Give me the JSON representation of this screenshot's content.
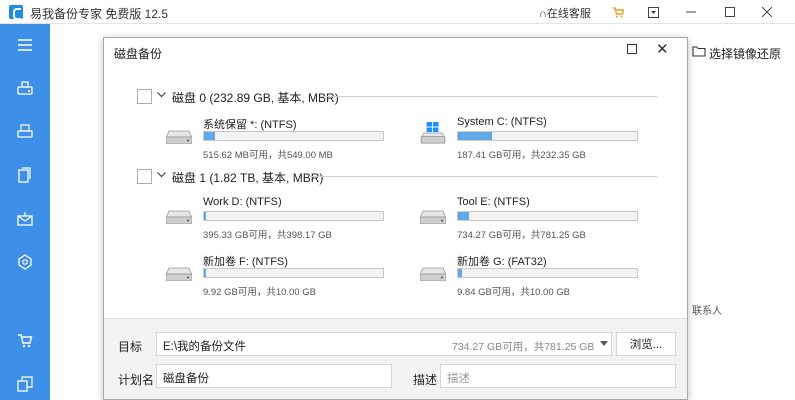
{
  "app": {
    "title": "易我备份专家 免费版 12.5",
    "online_help": "在线客服",
    "logo_icon": "app-logo-icon",
    "accent_color": "#3d8fe8"
  },
  "sidebar": {
    "items": [
      {
        "icon": "menu-icon"
      },
      {
        "icon": "disk-backup-icon"
      },
      {
        "icon": "system-backup-icon"
      },
      {
        "icon": "file-backup-icon"
      },
      {
        "icon": "mail-backup-icon"
      },
      {
        "icon": "smart-backup-icon"
      },
      {
        "icon": "cart-icon"
      },
      {
        "icon": "clone-icon"
      }
    ]
  },
  "background": {
    "restore_label": "选择镜像还原",
    "contact_label": "联系人"
  },
  "dialog": {
    "title": "磁盘备份",
    "disks": [
      {
        "label": "磁盘 0 (232.89 GB, 基本, MBR)",
        "partitions": [
          {
            "name": "系统保留 *: (NTFS)",
            "size": "515.62 MB可用，共549.00 MB",
            "used_fraction": 0.06,
            "icon": "drive-icon"
          },
          {
            "name": "System C: (NTFS)",
            "size": "187.41 GB可用，共232.35 GB",
            "used_fraction": 0.19,
            "icon": "windows-drive-icon"
          }
        ]
      },
      {
        "label": "磁盘 1 (1.82 TB, 基本, MBR)",
        "partitions": [
          {
            "name": "Work D: (NTFS)",
            "size": "395.33 GB可用，共398.17 GB",
            "used_fraction": 0.01,
            "icon": "drive-icon"
          },
          {
            "name": "Tool E: (NTFS)",
            "size": "734.27 GB可用，共781.25 GB",
            "used_fraction": 0.06,
            "icon": "drive-icon"
          },
          {
            "name": "新加卷 F: (NTFS)",
            "size": "9.92 GB可用，共10.00 GB",
            "used_fraction": 0.01,
            "icon": "drive-icon"
          },
          {
            "name": "新加卷 G: (FAT32)",
            "size": "9.84 GB可用，共10.00 GB",
            "used_fraction": 0.02,
            "icon": "drive-icon"
          }
        ]
      }
    ],
    "target": {
      "label": "目标",
      "value": "E:\\我的备份文件",
      "free": "734.27 GB可用，共781.25 GB",
      "browse": "浏览..."
    },
    "plan": {
      "label": "计划名",
      "value": "磁盘备份",
      "desc_label": "描述",
      "desc_placeholder": "描述"
    }
  }
}
